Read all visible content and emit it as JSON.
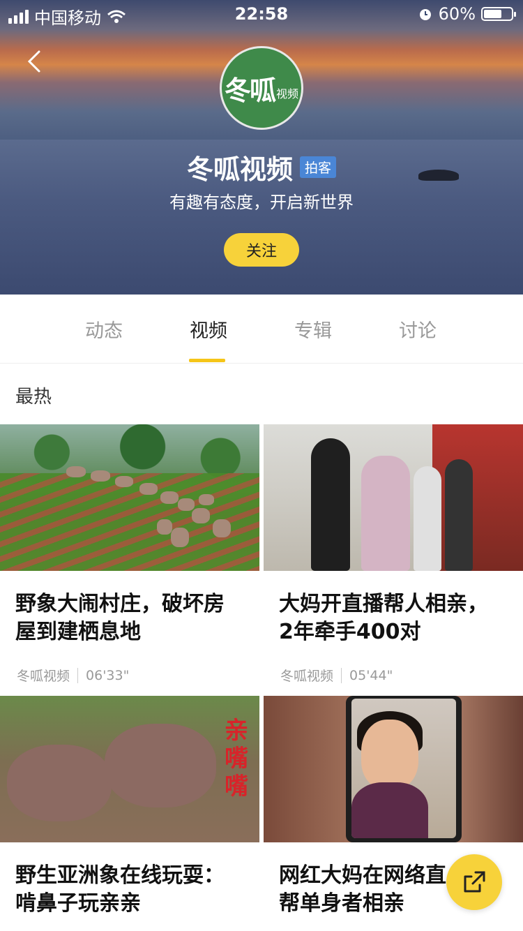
{
  "status_bar": {
    "carrier": "中国移动",
    "time": "22:58",
    "battery": "60%",
    "battery_level": 0.6
  },
  "profile": {
    "logo_text": "冬呱",
    "logo_small": "视频",
    "name": "冬呱视频",
    "tag": "拍客",
    "slogan": "有趣有态度，开启新世界",
    "follow_label": "关注"
  },
  "tabs": [
    {
      "label": "动态"
    },
    {
      "label": "视频"
    },
    {
      "label": "专辑"
    },
    {
      "label": "讨论"
    }
  ],
  "active_tab": "视频",
  "section_title": "最热",
  "videos": [
    {
      "title_line1": "野象大闹村庄，破坏房",
      "title_line2": "屋到建栖息地",
      "author": "冬呱视频",
      "duration": "06'33\""
    },
    {
      "title_line1": "大妈开直播帮人相亲，",
      "title_line2": "2年牵手400对",
      "author": "冬呱视频",
      "duration": "05'44\""
    },
    {
      "title_line1": "野生亚洲象在线玩耍：",
      "title_line2": "啃鼻子玩亲亲",
      "overlay_text": "亲嘴嘴"
    },
    {
      "title_line1": "网红大妈在网络直",
      "title_line2": "帮单身者相亲"
    }
  ],
  "colors": {
    "accent": "#f7d23a",
    "tag_blue": "#4a86d6",
    "logo_green": "#3f8a4a"
  }
}
